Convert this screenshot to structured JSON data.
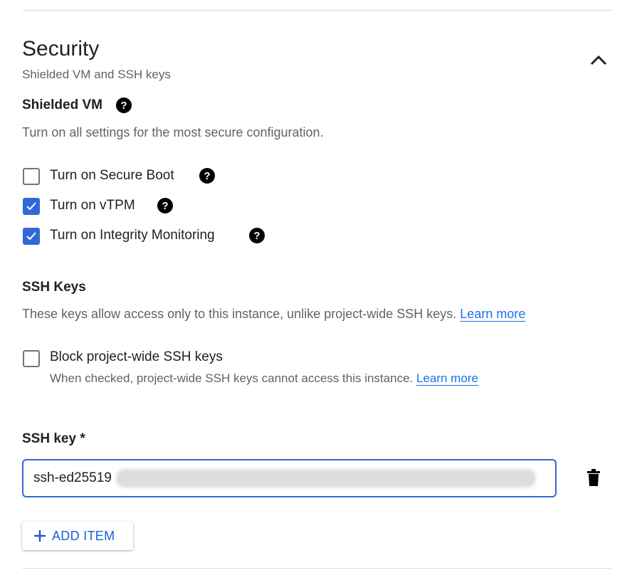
{
  "section": {
    "title": "Security",
    "subtitle": "Shielded VM and SSH keys",
    "expanded": true
  },
  "shielded": {
    "heading": "Shielded VM",
    "description": "Turn on all settings for the most secure configuration.",
    "options": [
      {
        "label": "Turn on Secure Boot",
        "checked": false
      },
      {
        "label": "Turn on vTPM",
        "checked": true
      },
      {
        "label": "Turn on Integrity Monitoring",
        "checked": true
      }
    ]
  },
  "ssh": {
    "heading": "SSH Keys",
    "description": "These keys allow access only to this instance, unlike project-wide SSH keys.",
    "learn_more": "Learn more",
    "block": {
      "label": "Block project-wide SSH keys",
      "checked": false,
      "hint": "When checked, project-wide SSH keys cannot access this instance.",
      "learn_more": "Learn more"
    },
    "key_label": "SSH key *",
    "key_value": "ssh-ed25519",
    "add_item": "ADD ITEM"
  },
  "colors": {
    "accent": "#3367d6",
    "link": "#1a73e8"
  }
}
